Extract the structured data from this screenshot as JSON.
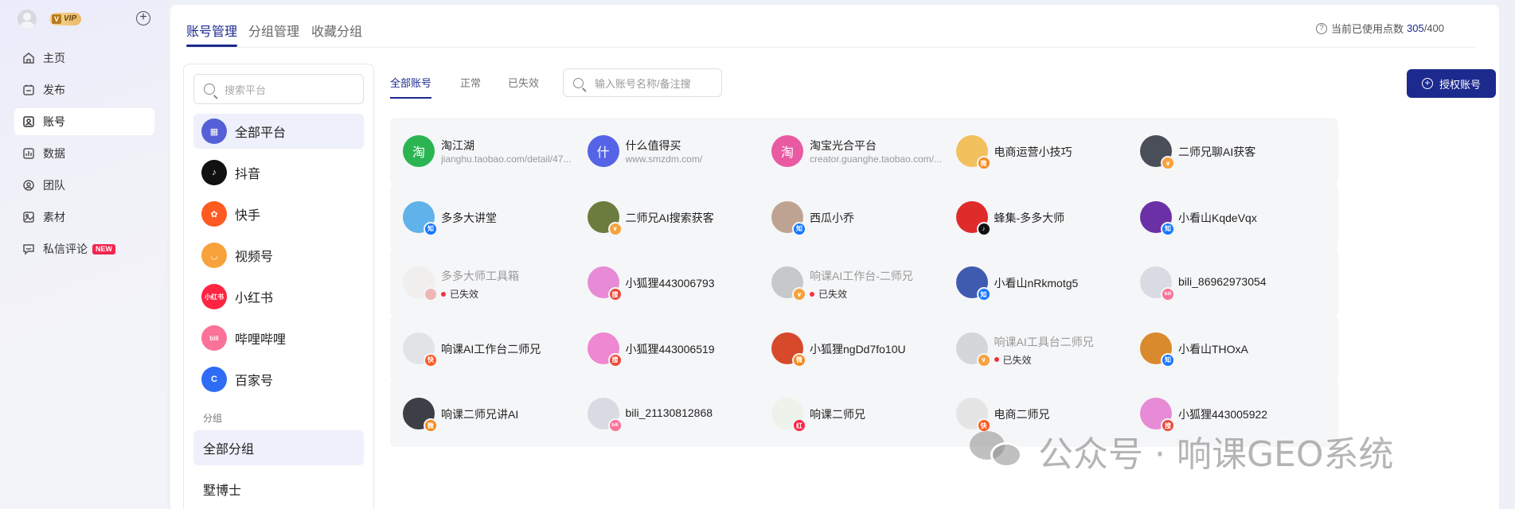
{
  "sidebar": {
    "vip_label": "VIP",
    "vip_mark": "V",
    "add_icon": "⊕",
    "nav": [
      {
        "label": "主页",
        "icon": "home-icon"
      },
      {
        "label": "发布",
        "icon": "publish-icon"
      },
      {
        "label": "账号",
        "icon": "account-icon",
        "active": true
      },
      {
        "label": "数据",
        "icon": "data-icon"
      },
      {
        "label": "团队",
        "icon": "team-icon"
      },
      {
        "label": "素材",
        "icon": "material-icon"
      },
      {
        "label": "私信评论",
        "icon": "message-icon",
        "badge": "NEW"
      }
    ]
  },
  "header": {
    "tabs": [
      "账号管理",
      "分组管理",
      "收藏分组"
    ],
    "usage_label": "当前已使用点数",
    "usage_used": "305",
    "usage_total": "/400",
    "help_icon": "?"
  },
  "platforms": {
    "search_placeholder": "搜索平台",
    "items": [
      {
        "label": "全部平台",
        "color": "#5560d8",
        "glyph": "▦",
        "active": true
      },
      {
        "label": "抖音",
        "color": "#111111",
        "glyph": "♪"
      },
      {
        "label": "快手",
        "color": "#ff5a1f",
        "glyph": "✿"
      },
      {
        "label": "视频号",
        "color": "#f7a23b",
        "glyph": "◡"
      },
      {
        "label": "小红书",
        "color": "#ff2442",
        "glyph": "小红书"
      },
      {
        "label": "哔哩哔哩",
        "color": "#fb7299",
        "glyph": "bili"
      },
      {
        "label": "百家号",
        "color": "#2f6cf6",
        "glyph": "C"
      }
    ],
    "group_label": "分组",
    "groups": [
      {
        "label": "全部分组",
        "active": true
      },
      {
        "label": "墅博士"
      }
    ]
  },
  "filters": {
    "tabs": [
      "全部账号",
      "正常",
      "已失效"
    ],
    "search_placeholder": "输入账号名称/备注搜",
    "auth_button": "授权账号"
  },
  "accounts": [
    {
      "name": "淘江湖",
      "url": "jianghu.taobao.com/detail/47...",
      "avatar": "淘",
      "color": "#2ab552"
    },
    {
      "name": "什么值得买",
      "url": "www.smzdm.com/",
      "avatar": "什",
      "color": "#5564e6"
    },
    {
      "name": "淘宝光合平台",
      "url": "creator.guanghe.taobao.com/...",
      "avatar": "淘",
      "color": "#e95aa3"
    },
    {
      "name": "电商运营小技巧",
      "avatar": "",
      "color": "#f2c15d",
      "badge": "微",
      "badge_color": "#f58a1f"
    },
    {
      "name": "二师兄聊AI获客",
      "avatar": "",
      "color": "#4a4e58",
      "badge": "∨",
      "badge_color": "#f7a23b"
    },
    {
      "name": "多多大讲堂",
      "avatar": "",
      "color": "#5fb2ea",
      "badge": "知",
      "badge_color": "#1677ff"
    },
    {
      "name": "二师兄AI搜索获客",
      "avatar": "",
      "color": "#6b7c3e",
      "badge": "∨",
      "badge_color": "#f7a23b"
    },
    {
      "name": "西瓜小乔",
      "avatar": "",
      "color": "#bfa392",
      "badge": "知",
      "badge_color": "#1677ff"
    },
    {
      "name": "蜂集-多多大师",
      "avatar": "",
      "color": "#e02b2b",
      "badge": "♪",
      "badge_color": "#111111"
    },
    {
      "name": "小看山KqdeVqx",
      "avatar": "",
      "color": "#6b2fa6",
      "badge": "知",
      "badge_color": "#1677ff"
    },
    {
      "name": "多多大师工具箱",
      "avatar": "",
      "color": "#ece7e4",
      "badge": "",
      "badge_color": "#f0b6b6",
      "expired": true,
      "status": "已失效"
    },
    {
      "name": "小狐狸443006793",
      "avatar": "",
      "color": "#e78bd6",
      "badge": "搜",
      "badge_color": "#e84b3c"
    },
    {
      "name": "响课AI工作台-二师兄",
      "avatar": "",
      "color": "#9a9a9a",
      "badge": "∨",
      "badge_color": "#f7a23b",
      "expired": true,
      "status": "已失效"
    },
    {
      "name": "小看山nRkmotg5",
      "avatar": "",
      "color": "#3f5bb0",
      "badge": "知",
      "badge_color": "#1677ff"
    },
    {
      "name": "bili_86962973054",
      "avatar": "",
      "color": "#d8dbe2",
      "badge": "bili",
      "badge_color": "#fb7299"
    },
    {
      "name": "响课AI工作台二师兄",
      "avatar": "",
      "color": "#e2e3e6",
      "badge": "快",
      "badge_color": "#ff5a1f"
    },
    {
      "name": "小狐狸443006519",
      "avatar": "",
      "color": "#ee88d0",
      "badge": "搜",
      "badge_color": "#e84b3c"
    },
    {
      "name": "小狐狸ngDd7fo10U",
      "avatar": "",
      "color": "#d6492a",
      "badge": "微",
      "badge_color": "#f58a1f"
    },
    {
      "name": "响课AI工具台二师兄",
      "avatar": "",
      "color": "#b5b5b5",
      "badge": "∨",
      "badge_color": "#f7a23b",
      "expired": true,
      "status": "已失效"
    },
    {
      "name": "小看山THOxA",
      "avatar": "",
      "color": "#d88a2c",
      "badge": "知",
      "badge_color": "#1677ff"
    },
    {
      "name": "响课二师兄讲AI",
      "avatar": "",
      "color": "#3c3f46",
      "badge": "微",
      "badge_color": "#f58a1f"
    },
    {
      "name": "bili_21130812868",
      "avatar": "",
      "color": "#d8dbe2",
      "badge": "bili",
      "badge_color": "#fb7299"
    },
    {
      "name": "响课二师兄",
      "avatar": "",
      "color": "#edf3ea",
      "badge": "红",
      "badge_color": "#ff2442"
    },
    {
      "name": "电商二师兄",
      "avatar": "",
      "color": "#e5e5e5",
      "badge": "快",
      "badge_color": "#ff5a1f"
    },
    {
      "name": "小狐狸443005922",
      "avatar": "",
      "color": "#e78bd6",
      "badge": "搜",
      "badge_color": "#e84b3c"
    }
  ],
  "watermark": {
    "text": "公众号 · 响课GEO系统"
  }
}
